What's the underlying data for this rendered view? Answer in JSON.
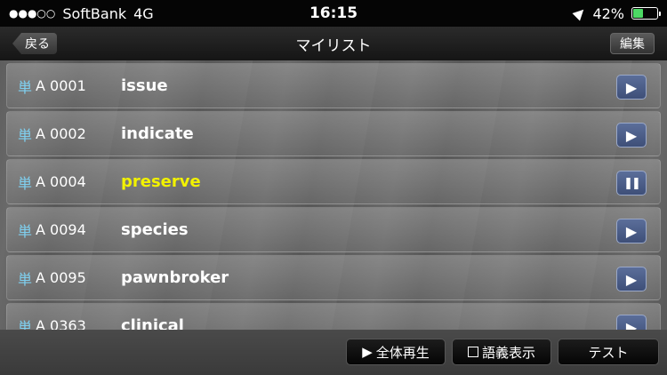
{
  "status_bar": {
    "signal": "●●●○○",
    "carrier": "SoftBank",
    "network": "4G",
    "time": "16:15",
    "battery": "42%",
    "battery_level": 0.42,
    "battery_color": "#4cd964"
  },
  "nav": {
    "back_label": "戻る",
    "title": "マイリスト",
    "edit_label": "編集"
  },
  "list": {
    "items": [
      {
        "tag": "単",
        "code": "A 0001",
        "word": "issue",
        "state": "play"
      },
      {
        "tag": "単",
        "code": "A 0002",
        "word": "indicate",
        "state": "play"
      },
      {
        "tag": "単",
        "code": "A 0004",
        "word": "preserve",
        "state": "pause"
      },
      {
        "tag": "単",
        "code": "A 0094",
        "word": "species",
        "state": "play"
      },
      {
        "tag": "単",
        "code": "A 0095",
        "word": "pawnbroker",
        "state": "play"
      },
      {
        "tag": "単",
        "code": "A 0363",
        "word": "clinical",
        "state": "play"
      }
    ],
    "play_glyph": "▶",
    "pause_glyph": "❚❚",
    "active_color": "#f2f200"
  },
  "toolbar": {
    "play_all_label": "全体再生",
    "show_meaning_label": "語義表示",
    "test_label": "テスト",
    "play_icon": "▶"
  }
}
